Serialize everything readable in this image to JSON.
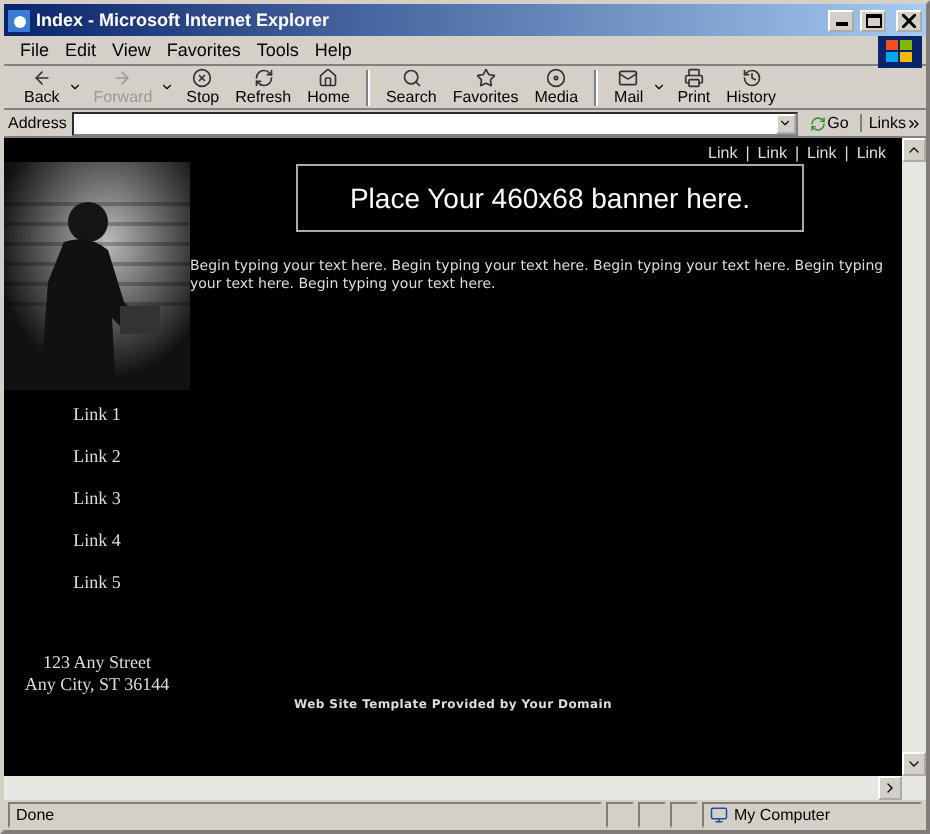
{
  "window": {
    "title": "Index - Microsoft Internet Explorer"
  },
  "menu": [
    "File",
    "Edit",
    "View",
    "Favorites",
    "Tools",
    "Help"
  ],
  "toolbar": {
    "groups": [
      [
        {
          "label": "Back",
          "dropdown": true,
          "disabled": false
        },
        {
          "label": "Forward",
          "dropdown": true,
          "disabled": true
        },
        {
          "label": "Stop",
          "dropdown": false,
          "disabled": false
        },
        {
          "label": "Refresh",
          "dropdown": false,
          "disabled": false
        },
        {
          "label": "Home",
          "dropdown": false,
          "disabled": false
        }
      ],
      [
        {
          "label": "Search",
          "dropdown": false,
          "disabled": false
        },
        {
          "label": "Favorites",
          "dropdown": false,
          "disabled": false
        },
        {
          "label": "Media",
          "dropdown": false,
          "disabled": false
        }
      ],
      [
        {
          "label": "Mail",
          "dropdown": true,
          "disabled": false
        },
        {
          "label": "Print",
          "dropdown": false,
          "disabled": false
        },
        {
          "label": "History",
          "dropdown": false,
          "disabled": false
        }
      ]
    ]
  },
  "address_bar": {
    "label": "Address",
    "go": "Go",
    "links": "Links"
  },
  "page": {
    "top_links": [
      "Link",
      "Link",
      "Link",
      "Link"
    ],
    "separator": "|",
    "banner": "Place Your 460x68 banner here.",
    "intro": "Begin typing your text here. Begin typing your text here. Begin typing your text here. Begin typing your text here. Begin typing your text here.",
    "side_links": [
      "Link 1",
      "Link 2",
      "Link 3",
      "Link 4",
      "Link 5"
    ],
    "address": [
      "123 Any Street",
      "Any City, ST 36144"
    ],
    "footer": "Web Site Template Provided by Your Domain"
  },
  "status_bar": {
    "text": "Done",
    "zone": "My Computer"
  }
}
